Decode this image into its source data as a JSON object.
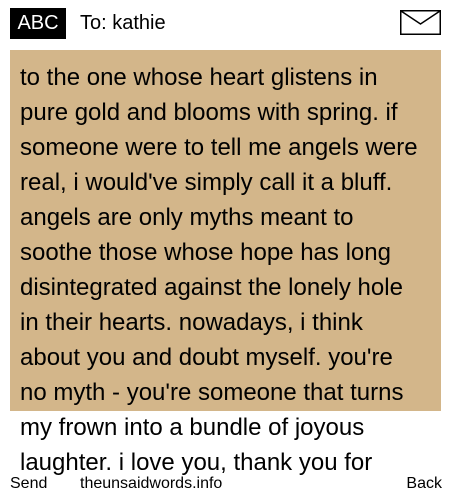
{
  "header": {
    "mode_label": "ABC",
    "recipient_label": "To: kathie",
    "icon": "envelope-icon"
  },
  "message": {
    "body": "to the one whose heart glistens in pure gold and blooms with spring. if someone were to tell me angels were real, i would've simply call it a bluff. angels are only myths meant to soothe those whose hope has long disintegrated against the lonely hole in their hearts. nowadays, i think about you and doubt myself. you're no myth - you're someone that turns my frown into a bundle of joyous laughter. i love you, thank you for",
    "background_color": "#d3b68a"
  },
  "softkeys": {
    "left": "Send",
    "center": "theunsaidwords.info",
    "right": "Back"
  }
}
